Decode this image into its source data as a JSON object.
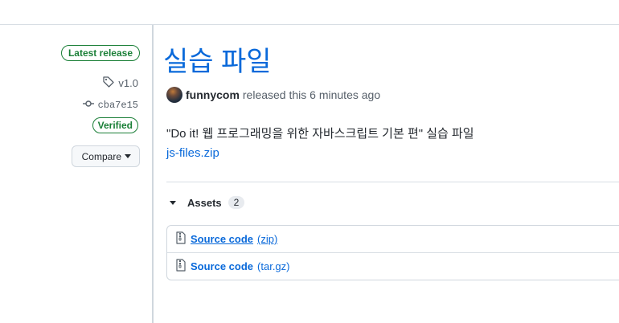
{
  "sidebar": {
    "latest_badge": "Latest release",
    "tag": "v1.0",
    "commit": "cba7e15",
    "verified_badge": "Verified",
    "compare_label": "Compare"
  },
  "release": {
    "title": "실습 파일",
    "author": "funnycom",
    "released_text": "released this 6 minutes ago",
    "description": "\"Do it! 웹 프로그래밍을 위한 자바스크립트 기본 편\" 실습 파일",
    "file_link": "js-files.zip"
  },
  "assets": {
    "label": "Assets",
    "count": "2",
    "items": [
      {
        "name": "Source code",
        "ext": "(zip)"
      },
      {
        "name": "Source code",
        "ext": "(tar.gz)"
      }
    ]
  },
  "colors": {
    "link": "#0969da",
    "success": "#1a7f37",
    "muted": "#57606a"
  }
}
